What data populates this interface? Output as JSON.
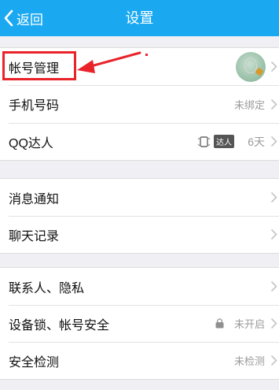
{
  "header": {
    "back_label": "返回",
    "title": "设置",
    "bar_color": "#1aa9f1"
  },
  "group1": {
    "items": [
      {
        "label": "帐号管理",
        "value": "",
        "icon": "avatar-icon"
      },
      {
        "label": "手机号码",
        "value": "未绑定"
      },
      {
        "label": "QQ达人",
        "value": "6天",
        "badge": "达人",
        "icon": "daren-icon"
      }
    ]
  },
  "group2": {
    "items": [
      {
        "label": "消息通知"
      },
      {
        "label": "聊天记录"
      }
    ]
  },
  "group3": {
    "items": [
      {
        "label": "联系人、隐私"
      },
      {
        "label": "设备锁、帐号安全",
        "value": "未开启",
        "icon": "lock-icon"
      },
      {
        "label": "安全检测",
        "value": "未检测"
      }
    ]
  },
  "annotation": {
    "color": "#e8232a"
  }
}
